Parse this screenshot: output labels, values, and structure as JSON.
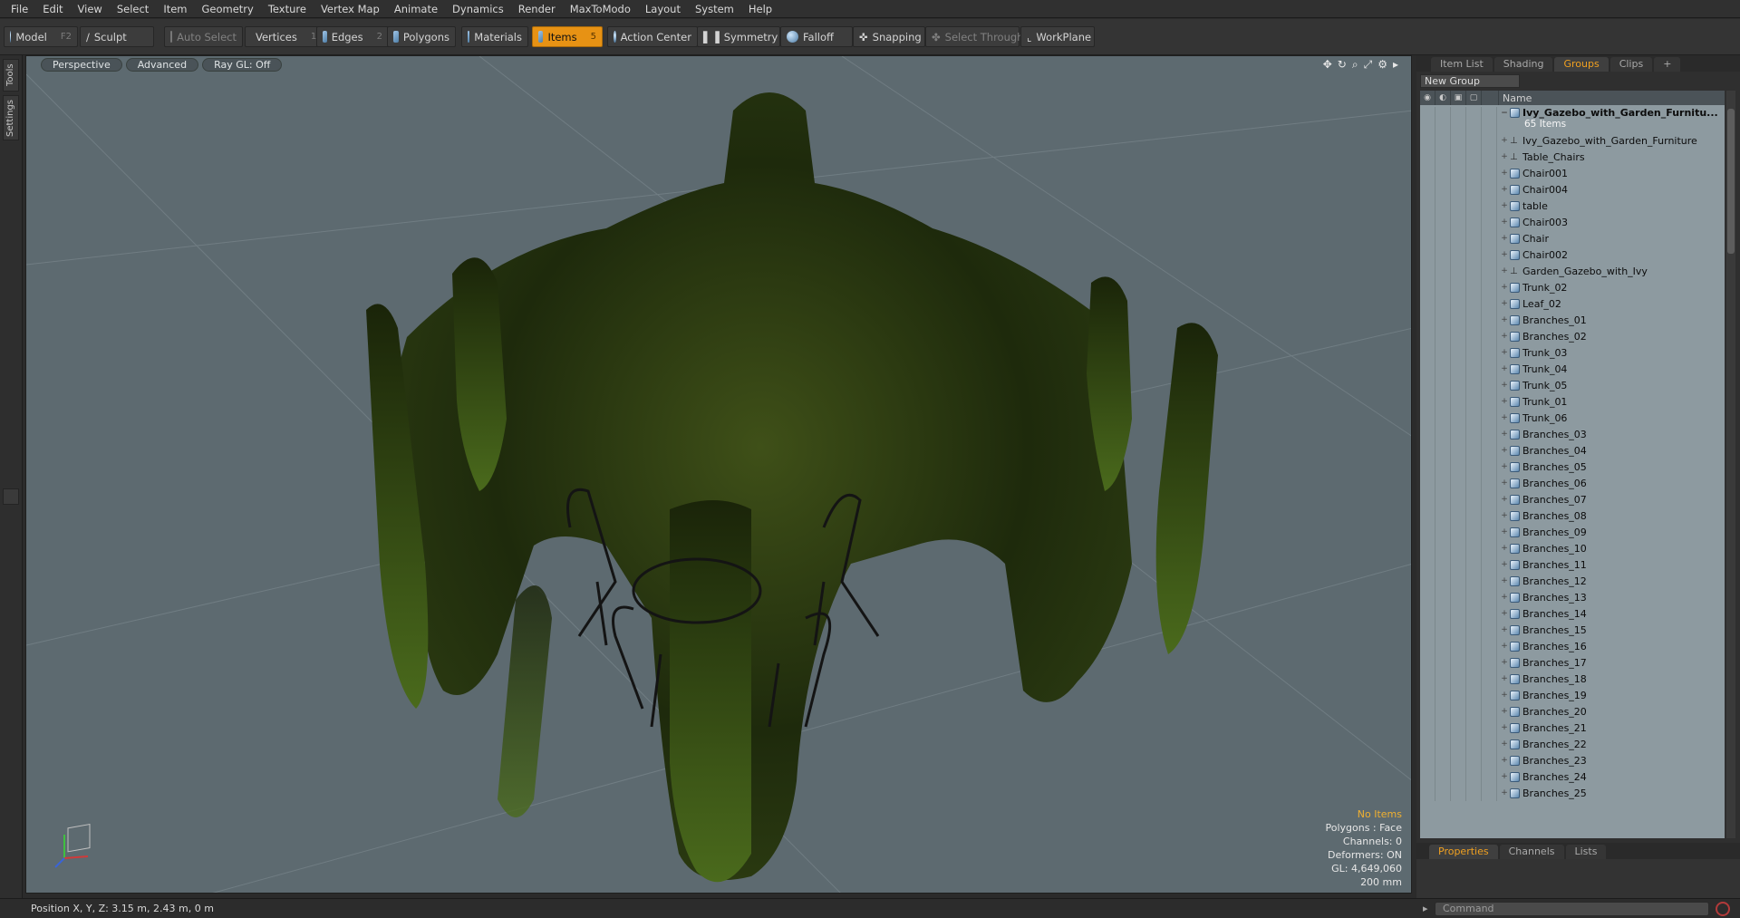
{
  "menu": [
    "File",
    "Edit",
    "View",
    "Select",
    "Item",
    "Geometry",
    "Texture",
    "Vertex Map",
    "Animate",
    "Dynamics",
    "Render",
    "MaxToModo",
    "Layout",
    "System",
    "Help"
  ],
  "toolbar": {
    "model": "Model",
    "model_key": "F2",
    "sculpt": "Sculpt",
    "auto_select": "Auto Select",
    "vertices": "Vertices",
    "vertices_key": "1",
    "edges": "Edges",
    "edges_key": "2",
    "polygons": "Polygons",
    "materials": "Materials",
    "items": "Items",
    "items_key": "5",
    "action_center": "Action Center",
    "symmetry": "Symmetry",
    "falloff": "Falloff",
    "snapping": "Snapping",
    "select_through": "Select Through",
    "workplane": "WorkPlane"
  },
  "left_tabs": {
    "tools": "Tools",
    "settings": "Settings"
  },
  "viewport": {
    "view": "Perspective",
    "shading": "Advanced",
    "raygl": "Ray GL: Off",
    "stats": {
      "items": "No Items",
      "polygons": "Polygons : Face",
      "channels": "Channels: 0",
      "deformers": "Deformers: ON",
      "gl": "GL: 4,649,060",
      "grid": "200 mm"
    }
  },
  "panel": {
    "tabs": [
      "Item List",
      "Shading",
      "Groups",
      "Clips"
    ],
    "active_tab": "Groups",
    "new_group": "New Group",
    "name_header": "Name",
    "group_name": "Ivy_Gazebo_with_Garden_Furnitu...",
    "group_count": "65 Items",
    "items": [
      {
        "name": "Ivy_Gazebo_with_Garden_Furniture",
        "icon": "locator-icon"
      },
      {
        "name": "Table_Chairs",
        "icon": "locator-icon"
      },
      {
        "name": "Chair001",
        "icon": "mesh-icon"
      },
      {
        "name": "Chair004",
        "icon": "mesh-icon"
      },
      {
        "name": "table",
        "icon": "mesh-icon"
      },
      {
        "name": "Chair003",
        "icon": "mesh-icon"
      },
      {
        "name": "Chair",
        "icon": "mesh-icon"
      },
      {
        "name": "Chair002",
        "icon": "mesh-icon"
      },
      {
        "name": "Garden_Gazebo_with_Ivy",
        "icon": "locator-icon"
      },
      {
        "name": "Trunk_02",
        "icon": "mesh-icon"
      },
      {
        "name": "Leaf_02",
        "icon": "mesh-icon"
      },
      {
        "name": "Branches_01",
        "icon": "mesh-icon"
      },
      {
        "name": "Branches_02",
        "icon": "mesh-icon"
      },
      {
        "name": "Trunk_03",
        "icon": "mesh-icon"
      },
      {
        "name": "Trunk_04",
        "icon": "mesh-icon"
      },
      {
        "name": "Trunk_05",
        "icon": "mesh-icon"
      },
      {
        "name": "Trunk_01",
        "icon": "mesh-icon"
      },
      {
        "name": "Trunk_06",
        "icon": "mesh-icon"
      },
      {
        "name": "Branches_03",
        "icon": "mesh-icon"
      },
      {
        "name": "Branches_04",
        "icon": "mesh-icon"
      },
      {
        "name": "Branches_05",
        "icon": "mesh-icon"
      },
      {
        "name": "Branches_06",
        "icon": "mesh-icon"
      },
      {
        "name": "Branches_07",
        "icon": "mesh-icon"
      },
      {
        "name": "Branches_08",
        "icon": "mesh-icon"
      },
      {
        "name": "Branches_09",
        "icon": "mesh-icon"
      },
      {
        "name": "Branches_10",
        "icon": "mesh-icon"
      },
      {
        "name": "Branches_11",
        "icon": "mesh-icon"
      },
      {
        "name": "Branches_12",
        "icon": "mesh-icon"
      },
      {
        "name": "Branches_13",
        "icon": "mesh-icon"
      },
      {
        "name": "Branches_14",
        "icon": "mesh-icon"
      },
      {
        "name": "Branches_15",
        "icon": "mesh-icon"
      },
      {
        "name": "Branches_16",
        "icon": "mesh-icon"
      },
      {
        "name": "Branches_17",
        "icon": "mesh-icon"
      },
      {
        "name": "Branches_18",
        "icon": "mesh-icon"
      },
      {
        "name": "Branches_19",
        "icon": "mesh-icon"
      },
      {
        "name": "Branches_20",
        "icon": "mesh-icon"
      },
      {
        "name": "Branches_21",
        "icon": "mesh-icon"
      },
      {
        "name": "Branches_22",
        "icon": "mesh-icon"
      },
      {
        "name": "Branches_23",
        "icon": "mesh-icon"
      },
      {
        "name": "Branches_24",
        "icon": "mesh-icon"
      },
      {
        "name": "Branches_25",
        "icon": "mesh-icon"
      }
    ],
    "props_tabs": [
      "Properties",
      "Channels",
      "Lists"
    ],
    "props_active": "Properties"
  },
  "status": {
    "position": "Position X, Y, Z:   3.15 m, 2.43 m, 0 m",
    "command_placeholder": "Command"
  },
  "colors": {
    "accent": "#e79214",
    "viewport_bg": "#5d6a70",
    "foliage": "#2c3a14"
  }
}
